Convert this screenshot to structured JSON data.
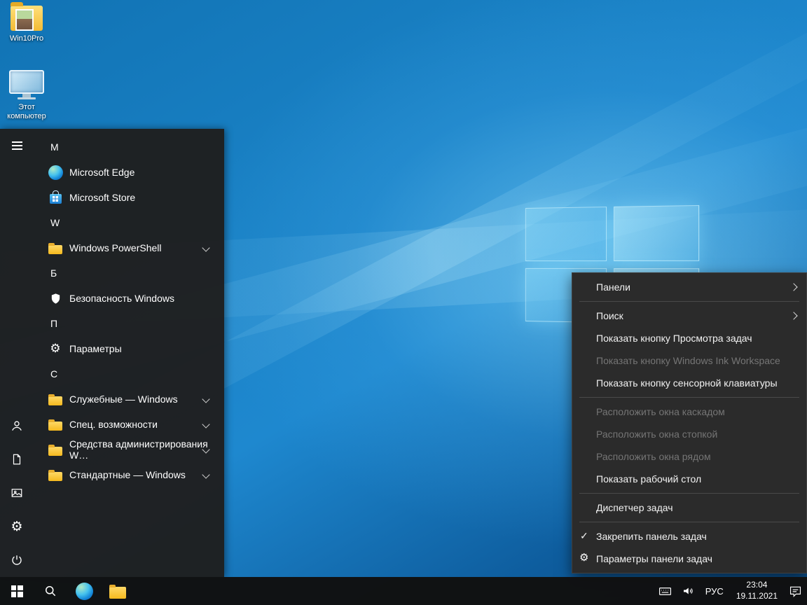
{
  "colors": {
    "desktop_blue": "#1e88cf",
    "taskbar_bg": "#101010",
    "menu_bg": "#1f1f1f",
    "context_bg": "#2b2b2b",
    "disabled_text": "#757575",
    "folder_yellow": "#f5b91e"
  },
  "desktop": {
    "icons": [
      {
        "label": "Win10Pro",
        "icon": "folder-with-photo-icon"
      },
      {
        "label": "Этот компьютер",
        "icon": "computer-icon"
      }
    ]
  },
  "start_menu": {
    "rail_icons": [
      "hamburger-icon",
      "user-icon",
      "document-icon",
      "pictures-icon",
      "gear-icon",
      "power-icon"
    ],
    "sections": [
      {
        "letter": "M",
        "items": [
          {
            "label": "Microsoft Edge",
            "icon": "edge-icon",
            "expandable": false
          },
          {
            "label": "Microsoft Store",
            "icon": "store-icon",
            "expandable": false
          }
        ]
      },
      {
        "letter": "W",
        "items": [
          {
            "label": "Windows PowerShell",
            "icon": "folder-icon",
            "expandable": true
          }
        ]
      },
      {
        "letter": "Б",
        "items": [
          {
            "label": "Безопасность Windows",
            "icon": "shield-icon",
            "expandable": false
          }
        ]
      },
      {
        "letter": "П",
        "items": [
          {
            "label": "Параметры",
            "icon": "gear-icon",
            "expandable": false
          }
        ]
      },
      {
        "letter": "С",
        "items": [
          {
            "label": "Служебные — Windows",
            "icon": "folder-icon",
            "expandable": true
          },
          {
            "label": "Спец. возможности",
            "icon": "folder-icon",
            "expandable": true
          },
          {
            "label": "Средства администрирования W…",
            "icon": "folder-icon",
            "expandable": true
          },
          {
            "label": "Стандартные — Windows",
            "icon": "folder-icon",
            "expandable": true
          }
        ]
      }
    ]
  },
  "context_menu": {
    "items": [
      {
        "label": "Панели",
        "enabled": true,
        "submenu": true
      },
      {
        "label": "Поиск",
        "enabled": true,
        "submenu": true
      },
      {
        "label": "Показать кнопку Просмотра задач",
        "enabled": true
      },
      {
        "label": "Показать кнопку Windows Ink Workspace",
        "enabled": false
      },
      {
        "label": "Показать кнопку сенсорной клавиатуры",
        "enabled": true
      },
      {
        "label": "Расположить окна каскадом",
        "enabled": false
      },
      {
        "label": "Расположить окна стопкой",
        "enabled": false
      },
      {
        "label": "Расположить окна рядом",
        "enabled": false
      },
      {
        "label": "Показать рабочий стол",
        "enabled": true
      },
      {
        "label": "Диспетчер задач",
        "enabled": true
      },
      {
        "label": "Закрепить панель задач",
        "enabled": true,
        "checked": true,
        "check_glyph": "✓"
      },
      {
        "label": "Параметры панели задач",
        "enabled": true,
        "icon": "gear-icon",
        "gear_glyph": "⚙"
      }
    ]
  },
  "taskbar": {
    "buttons": [
      "windows-start-icon",
      "search-icon",
      "edge-icon",
      "file-explorer-icon"
    ],
    "tray": {
      "icons": [
        "touch-keyboard-icon",
        "volume-icon",
        "action-center-icon"
      ],
      "language": "РУС",
      "time": "23:04",
      "date": "19.11.2021"
    }
  },
  "glyphs": {
    "gear": "⚙"
  }
}
